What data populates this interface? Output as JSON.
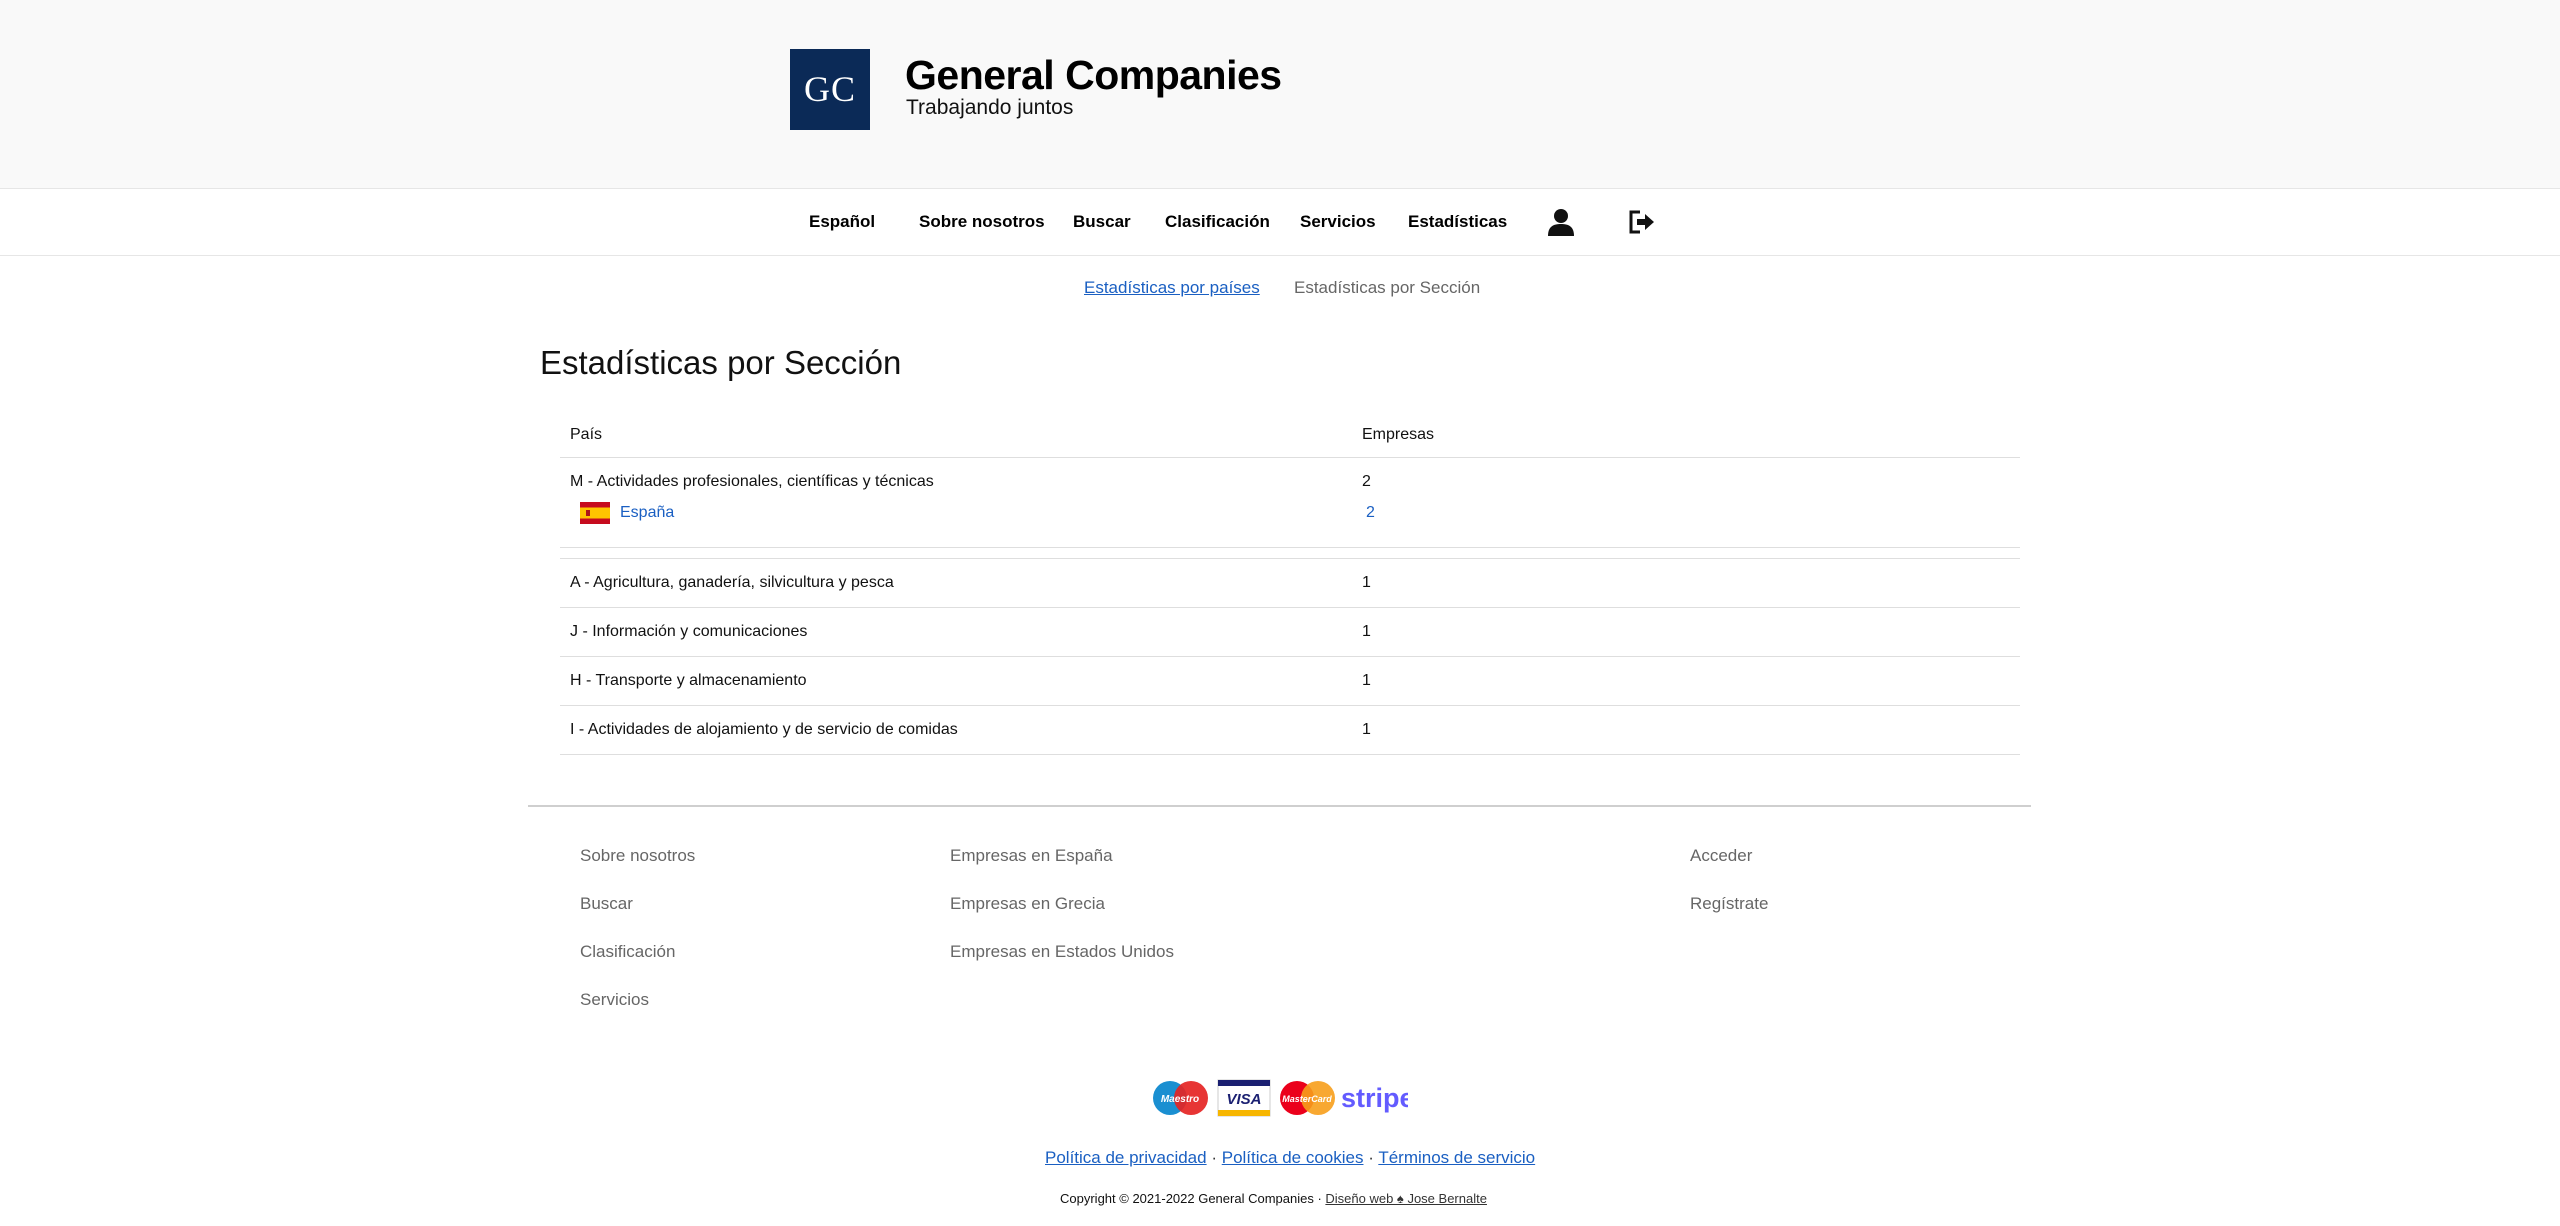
{
  "brand": {
    "logo_text": "GC",
    "name": "General Companies",
    "tagline": "Trabajando juntos"
  },
  "nav": {
    "language": "Español",
    "items": [
      "Sobre nosotros",
      "Buscar",
      "Clasificación",
      "Servicios",
      "Estadísticas"
    ],
    "icons": [
      "user-icon",
      "logout-icon"
    ]
  },
  "subnav": {
    "link": "Estadísticas por países",
    "current": "Estadísticas por Sección"
  },
  "page_title": "Estadísticas por Sección",
  "table": {
    "headers": [
      "País",
      "Empresas"
    ],
    "groups": [
      {
        "section": "M - Actividades profesionales, científicas y técnicas",
        "count": "2",
        "sub": {
          "country": "España",
          "count": "2",
          "flag": "spain-flag-icon"
        }
      }
    ],
    "rows": [
      {
        "section": "A - Agricultura, ganadería, silvicultura y pesca",
        "count": "1"
      },
      {
        "section": "J - Información y comunicaciones",
        "count": "1"
      },
      {
        "section": "H - Transporte y almacenamiento",
        "count": "1"
      },
      {
        "section": "I - Actividades de alojamiento y de servicio de comidas",
        "count": "1"
      }
    ]
  },
  "footer": {
    "col1": [
      "Sobre nosotros",
      "Buscar",
      "Clasificación",
      "Servicios"
    ],
    "col2": [
      "Empresas en España",
      "Empresas en Grecia",
      "Empresas en Estados Unidos"
    ],
    "col3": [
      "Acceder",
      "Regístrate"
    ],
    "payments": {
      "maestro": "Maestro",
      "visa": "VISA",
      "mastercard": "MasterCard",
      "stripe": "stripe"
    },
    "legal": {
      "privacy": "Política de privacidad",
      "cookies": "Política de cookies",
      "terms": "Términos de servicio",
      "separator": "·"
    },
    "copyright": {
      "text": "Copyright © 2021-2022 General Companies · ",
      "designer": "Diseño web ♠ Jose Bernalte"
    }
  },
  "colors": {
    "brand_navy": "#0b2a57",
    "link_blue": "#1a5fc2",
    "stripe_purple": "#635bff"
  }
}
